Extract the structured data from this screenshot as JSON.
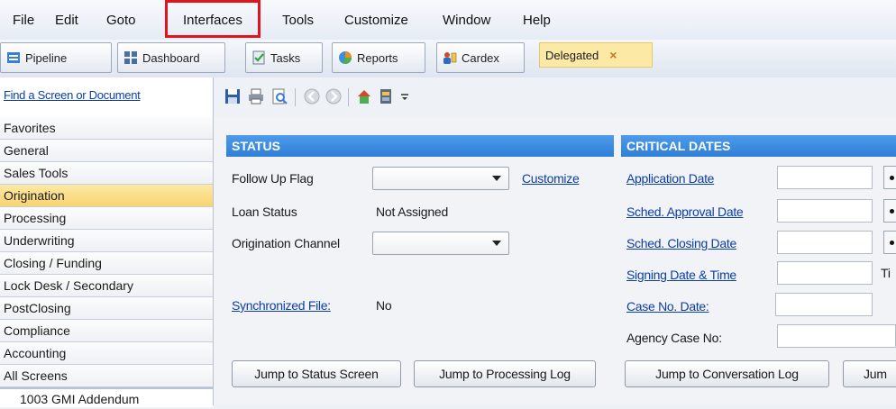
{
  "menu": {
    "file": "File",
    "edit": "Edit",
    "goto": "Goto",
    "interfaces": "Interfaces",
    "tools": "Tools",
    "customize": "Customize",
    "window": "Window",
    "help": "Help"
  },
  "toolbar": {
    "pipeline": "Pipeline",
    "dashboard": "Dashboard",
    "tasks": "Tasks",
    "reports": "Reports",
    "cardex": "Cardex",
    "delegated_tab": "Delegated",
    "delegated_close": "×"
  },
  "sidebar": {
    "find_link": "Find a Screen or Document",
    "items": [
      {
        "label": "Favorites"
      },
      {
        "label": "General"
      },
      {
        "label": "Sales Tools"
      },
      {
        "label": "Origination"
      },
      {
        "label": "Processing"
      },
      {
        "label": "Underwriting"
      },
      {
        "label": "Closing / Funding"
      },
      {
        "label": "Lock Desk / Secondary"
      },
      {
        "label": "PostClosing"
      },
      {
        "label": "Compliance"
      },
      {
        "label": "Accounting"
      },
      {
        "label": "All Screens"
      }
    ],
    "active_item": "Origination",
    "sub_item": "1003 GMI Addendum"
  },
  "status": {
    "header": "STATUS",
    "follow_up_flag_label": "Follow Up Flag",
    "customize_link": "Customize",
    "loan_status_label": "Loan Status",
    "loan_status_value": "Not Assigned",
    "origination_channel_label": "Origination Channel",
    "synchronized_file_label": "Synchronized File:",
    "synchronized_file_value": "No"
  },
  "critical_dates": {
    "header": "CRITICAL DATES",
    "application_date": "Application Date",
    "sched_approval_date": "Sched. Approval Date",
    "sched_closing_date": "Sched. Closing Date",
    "signing_date_time": "Signing Date & Time",
    "case_no_date": "Case No. Date:",
    "agency_case_no": "Agency Case No:",
    "signing_suffix": "Ti"
  },
  "buttons": {
    "jump_status": "Jump to Status Screen",
    "jump_processing": "Jump to Processing Log",
    "jump_conversation": "Jump to Conversation Log",
    "jump_cut": "Jum"
  },
  "colors": {
    "highlight": "#e0141d",
    "section_header": "#3a8be0",
    "active_item": "#fde08a",
    "link": "#0b3ea8"
  }
}
